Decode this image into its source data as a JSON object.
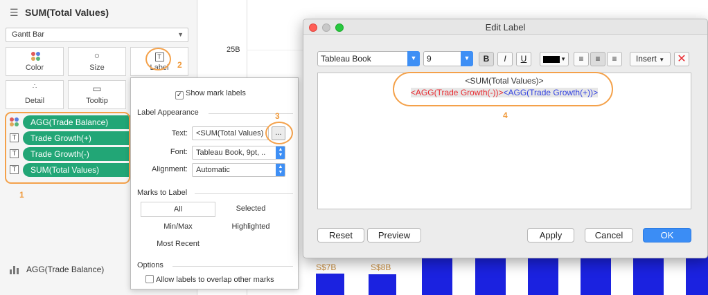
{
  "marks": {
    "title": "SUM(Total Values)",
    "mark_type": "Gantt Bar",
    "buttons": [
      "Color",
      "Size",
      "Label",
      "Detail",
      "Tooltip"
    ],
    "pills": [
      "AGG(Trade Balance)",
      "Trade Growth(+)",
      "Trade Growth(-)",
      "SUM(Total Values)"
    ],
    "bottom_shelf": "AGG(Trade Balance)"
  },
  "annotations": {
    "n1": "1",
    "n2": "2",
    "n3": "3",
    "n4": "4"
  },
  "chart": {
    "y_tick": "25B",
    "bar_labels": [
      "S$7B",
      "S$8B"
    ]
  },
  "popover": {
    "show_mark_labels": "Show mark labels",
    "label_appearance": "Label Appearance",
    "text_label": "Text:",
    "text_value": "<SUM(Total Values)",
    "ellipsis": "...",
    "font_label": "Font:",
    "font_value": "Tableau Book, 9pt, ..",
    "alignment_label": "Alignment:",
    "alignment_value": "Automatic",
    "marks_to_label": "Marks to Label",
    "options_marks": [
      "All",
      "Selected",
      "Min/Max",
      "Highlighted",
      "Most Recent"
    ],
    "options": "Options",
    "allow_overlap": "Allow labels to overlap other marks"
  },
  "dialog": {
    "title": "Edit Label",
    "font": "Tableau Book",
    "size": "9",
    "bold": "B",
    "italic": "I",
    "underline": "U",
    "insert": "Insert",
    "line1": "<SUM(Total Values)>",
    "line2_a": "<AGG(Trade Growth(-))>",
    "line2_b": "<AGG(Trade Growth(+))>",
    "buttons": {
      "reset": "Reset",
      "preview": "Preview",
      "apply": "Apply",
      "cancel": "Cancel",
      "ok": "OK"
    }
  },
  "colors": {
    "pill": "#22a676",
    "bar": "#1b22e0",
    "annotation": "#f4a14a",
    "growth_neg": "#e8292f",
    "growth_pos": "#2f3fe0",
    "ok_button": "#3b8df5"
  }
}
